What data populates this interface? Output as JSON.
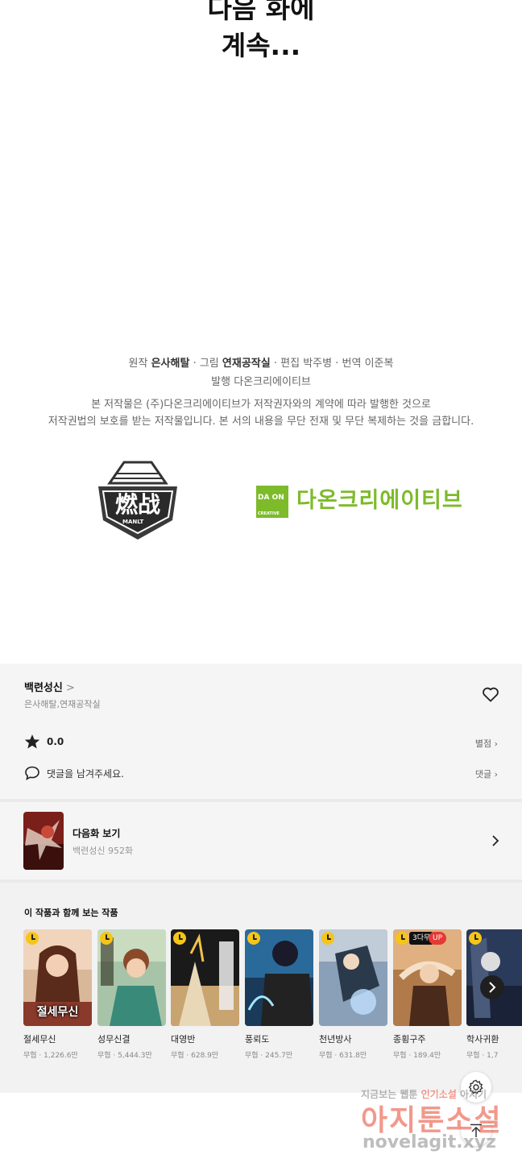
{
  "continued": {
    "line1": "다음 화에",
    "line2": "계속..."
  },
  "credits": {
    "original_label": "원작",
    "original": "은사해탈",
    "art_label": "그림",
    "art": "연재공작실",
    "editor_label": "편집",
    "editor": "박주병",
    "translator_label": "번역",
    "translator": "이준복",
    "publisher_label": "발행",
    "publisher": "다온크리에이티브",
    "sep": "·"
  },
  "copyright": {
    "line1": "본 저작물은 (주)다온크리에이티브가 저작권자와의 계약에 따라 발행한 것으로",
    "line2": "저작권법의 보호를 받는 저작물입니다. 본 서의 내용을 무단 전재 및 무단 복제하는 것을 금합니다."
  },
  "logos": {
    "studio": "MANLT",
    "daon_box_1": "DA ON",
    "daon_box_2": "CREATIVE",
    "daon_name": "다온크리에이티브",
    "brand_green": "#7dbb2a"
  },
  "series": {
    "title": "백련성신",
    "chevron": ">",
    "authors": "은사해탈,연재공작실",
    "rating": "0.0",
    "rate_link": "별점",
    "comment_placeholder": "댓글을 남겨주세요.",
    "comment_link": "댓글"
  },
  "next_episode": {
    "label": "다음화 보기",
    "sub": "백련성신 952화"
  },
  "recommend": {
    "heading": "이 작품과 함께 보는 작품",
    "items": [
      {
        "name": "절세무신",
        "stat": "무협 · 1,226.6만",
        "cover_text": "절세무신",
        "badge3d": "",
        "badge_up": ""
      },
      {
        "name": "성무신결",
        "stat": "무협 · 5,444.3만",
        "cover_text": "",
        "badge3d": "",
        "badge_up": ""
      },
      {
        "name": "대영반",
        "stat": "무협 · 628.9만",
        "cover_text": "",
        "badge3d": "",
        "badge_up": ""
      },
      {
        "name": "풍뢰도",
        "stat": "무협 · 245.7만",
        "cover_text": "",
        "badge3d": "",
        "badge_up": ""
      },
      {
        "name": "천년방사",
        "stat": "무협 · 631.8만",
        "cover_text": "",
        "badge3d": "",
        "badge_up": ""
      },
      {
        "name": "종횡구주",
        "stat": "무협 · 189.4만",
        "cover_text": "",
        "badge3d": "3다무",
        "badge_up": "UP"
      },
      {
        "name": "학사귀환",
        "stat": "무협 · 1,7",
        "cover_text": "",
        "badge3d": "",
        "badge_up": ""
      }
    ]
  },
  "watermark": {
    "top_gray": "지금보는 웹툰",
    "top_red": "인기소설",
    "top_tail": "아지기",
    "main": "아지툰소설",
    "url": "novelagit.xyz"
  }
}
